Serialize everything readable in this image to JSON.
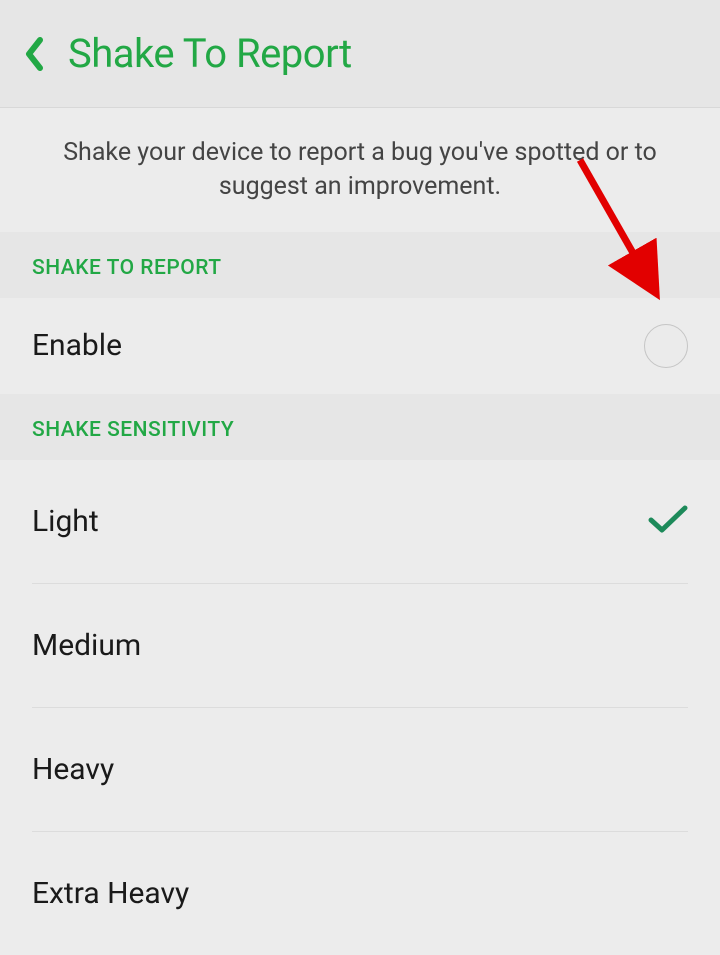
{
  "header": {
    "title": "Shake To Report"
  },
  "description": "Shake your device to report a bug you've spotted or to suggest an improvement.",
  "sections": {
    "shake_to_report": {
      "header": "SHAKE TO REPORT",
      "enable_label": "Enable",
      "enabled": false
    },
    "shake_sensitivity": {
      "header": "SHAKE SENSITIVITY",
      "options": [
        {
          "label": "Light",
          "selected": true
        },
        {
          "label": "Medium",
          "selected": false
        },
        {
          "label": "Heavy",
          "selected": false
        },
        {
          "label": "Extra Heavy",
          "selected": false
        }
      ]
    }
  },
  "annotation": {
    "arrow_color": "#e20000"
  }
}
